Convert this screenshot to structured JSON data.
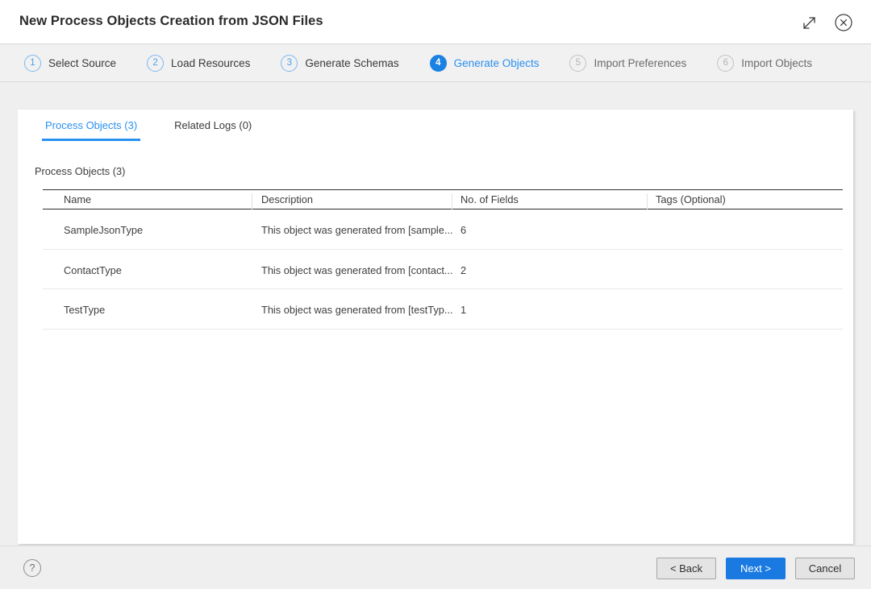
{
  "window": {
    "title": "New Process Objects Creation from JSON Files",
    "expand_icon": "expand-diagonal-icon",
    "close_icon": "close-circle-icon"
  },
  "stepper": {
    "steps": [
      {
        "number": "1",
        "label": "Select Source",
        "state": "done"
      },
      {
        "number": "2",
        "label": "Load Resources",
        "state": "done"
      },
      {
        "number": "3",
        "label": "Generate Schemas",
        "state": "done"
      },
      {
        "number": "4",
        "label": "Generate Objects",
        "state": "current"
      },
      {
        "number": "5",
        "label": "Import Preferences",
        "state": "future"
      },
      {
        "number": "6",
        "label": "Import Objects",
        "state": "future"
      }
    ]
  },
  "panel": {
    "tabs": [
      {
        "label": "Process Objects (3)",
        "active": true
      },
      {
        "label": "Related Logs (0)",
        "active": false
      }
    ],
    "section_caption": "Process Objects (3)",
    "table": {
      "columns": [
        "Name",
        "Description",
        "No. of Fields",
        "Tags (Optional)"
      ],
      "rows": [
        {
          "name": "SampleJsonType",
          "description": "This object was generated from [sample...",
          "fields": "6",
          "tags": ""
        },
        {
          "name": "ContactType",
          "description": "This object was generated from [contact...",
          "fields": "2",
          "tags": ""
        },
        {
          "name": "TestType",
          "description": "This object was generated from [testTyp...",
          "fields": "1",
          "tags": ""
        }
      ]
    }
  },
  "footer": {
    "help_icon": "question-mark-icon",
    "back_label": "< Back",
    "next_label": "Next >",
    "cancel_label": "Cancel"
  },
  "colors": {
    "accent_blue": "#1a82e2",
    "link_blue": "#2a90f0",
    "primary_button": "#1a7ae2",
    "panel_bg": "#ffffff",
    "page_bg": "#efefef"
  }
}
